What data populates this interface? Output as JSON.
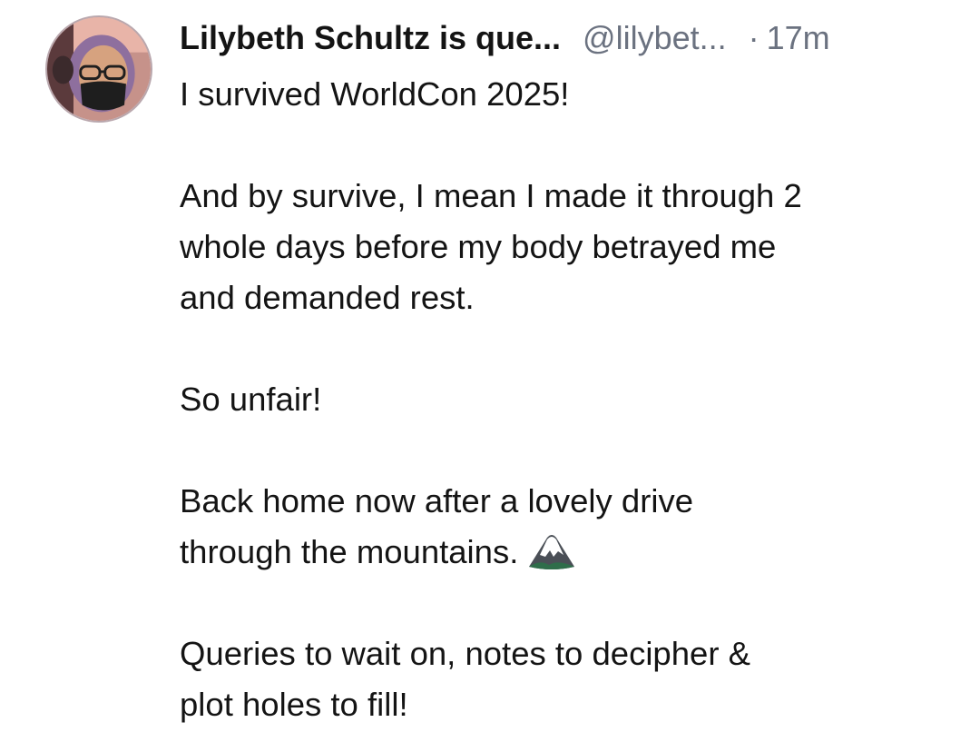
{
  "post": {
    "author": {
      "display_name": "Lilybeth Schultz is que...",
      "handle": "@lilybet...",
      "avatar_icon": "profile-photo"
    },
    "separator": "·",
    "timestamp": "17m",
    "body": {
      "p1": "I survived WorldCon 2025!",
      "p2_l1": "And by survive, I mean I made it through 2",
      "p2_l2": "whole days before my body betrayed me",
      "p2_l3": "and demanded rest.",
      "p3": "So unfair!",
      "p4_l1": "Back home now after a lovely drive",
      "p4_l2": "through the mountains.",
      "p4_emoji": "mountain-emoji",
      "p5_l1": "Queries to wait on, notes to decipher &",
      "p5_l2": "plot holes to fill!"
    }
  }
}
